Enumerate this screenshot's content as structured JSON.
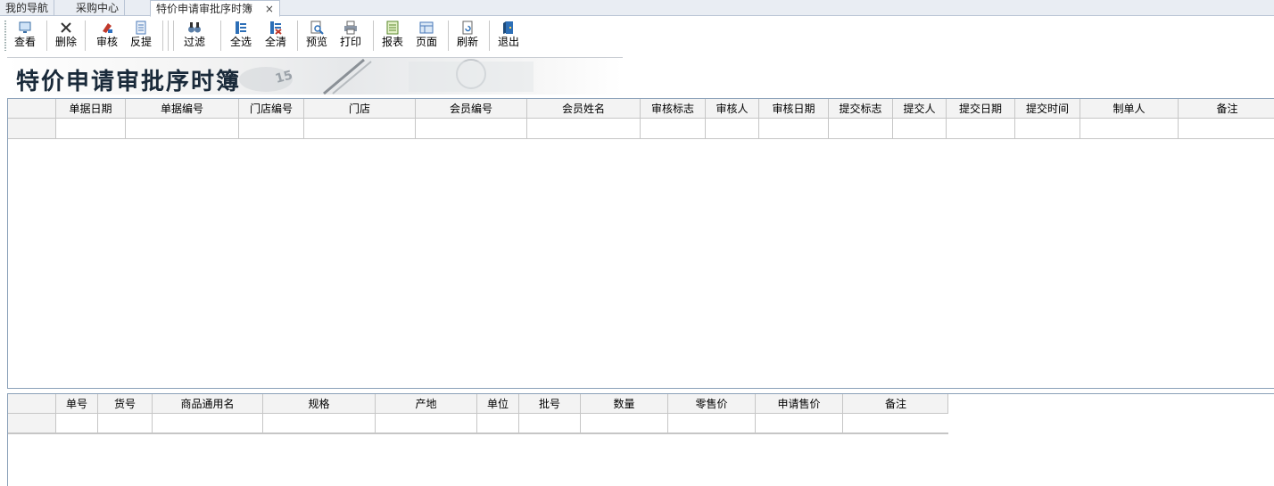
{
  "tabs": [
    {
      "label": "我的导航"
    },
    {
      "label": "采购中心"
    },
    {
      "label": "特价申请审批序时簿",
      "active": true,
      "close": "×"
    }
  ],
  "toolbar": {
    "buttons": [
      {
        "label": "查看",
        "icon": "view-icon"
      },
      {
        "label": "删除",
        "icon": "delete-icon"
      },
      {
        "label": "审核",
        "icon": "approve-icon"
      },
      {
        "label": "反提",
        "icon": "reverse-icon"
      },
      {
        "label": "过滤",
        "icon": "binoculars-icon"
      },
      {
        "label": "全选",
        "icon": "select-all-icon"
      },
      {
        "label": "全清",
        "icon": "clear-all-icon"
      },
      {
        "label": "预览",
        "icon": "preview-icon"
      },
      {
        "label": "打印",
        "icon": "printer-icon"
      },
      {
        "label": "报表",
        "icon": "report-icon"
      },
      {
        "label": "页面",
        "icon": "page-icon"
      },
      {
        "label": "刷新",
        "icon": "refresh-icon"
      },
      {
        "label": "退出",
        "icon": "exit-icon"
      }
    ]
  },
  "banner": {
    "title": "特价申请审批序时簿"
  },
  "main_grid": {
    "columns": [
      "单据日期",
      "单据编号",
      "门店编号",
      "门店",
      "会员编号",
      "会员姓名",
      "审核标志",
      "审核人",
      "审核日期",
      "提交标志",
      "提交人",
      "提交日期",
      "提交时间",
      "制单人",
      "备注"
    ],
    "rows": [
      [
        "",
        "",
        "",
        "",
        "",
        "",
        "",
        "",
        "",
        "",
        "",
        "",
        "",
        "",
        ""
      ]
    ]
  },
  "detail_grid": {
    "columns": [
      "单号",
      "货号",
      "商品通用名",
      "规格",
      "产地",
      "单位",
      "批号",
      "数量",
      "零售价",
      "申请售价",
      "备注"
    ],
    "rows": [
      [
        "",
        "",
        "",
        "",
        "",
        "",
        "",
        "",
        "",
        "",
        ""
      ]
    ]
  },
  "colors": {
    "tab_bg": "#e9edf3",
    "grid_border": "#8aa0b8",
    "header_bg": "#f3f3f3"
  }
}
